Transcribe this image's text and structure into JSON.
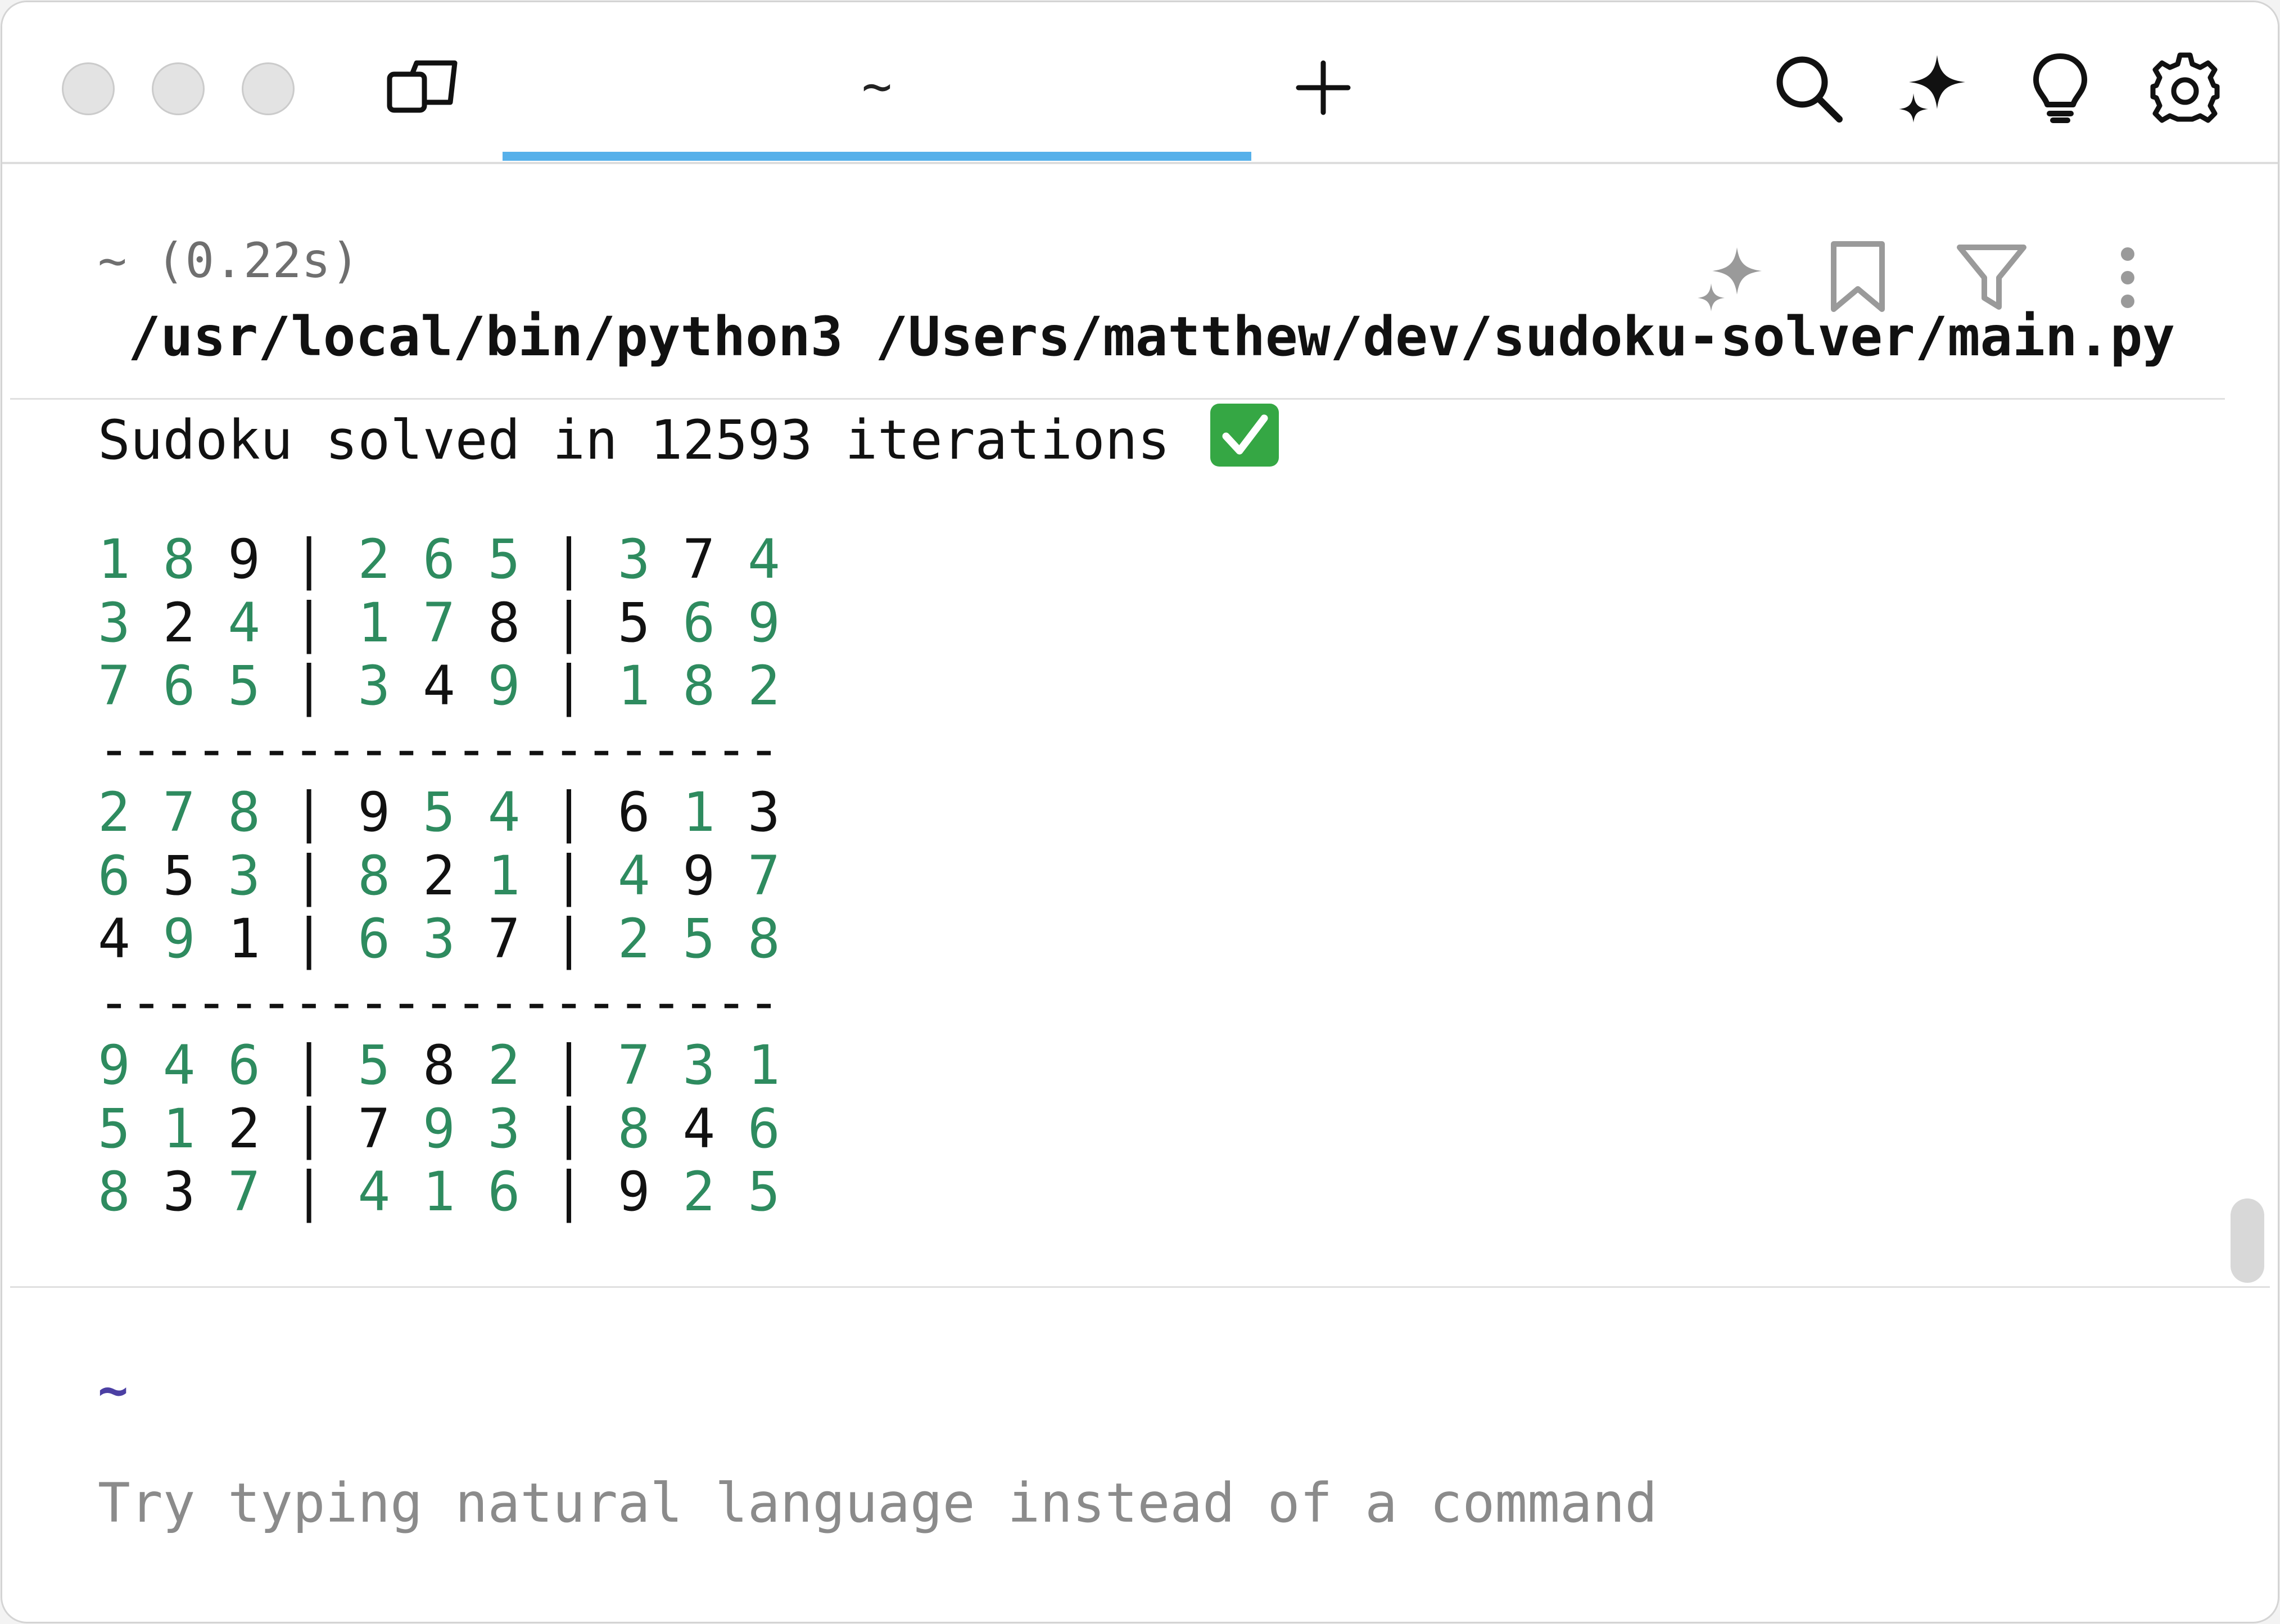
{
  "window": {
    "traffic_lights": [
      "close",
      "minimize",
      "zoom"
    ]
  },
  "tabs": [
    {
      "label": "~",
      "active": true
    }
  ],
  "toolbar": {
    "icons": [
      "search-icon",
      "ai-sparkle-icon",
      "lightbulb-icon",
      "gear-icon"
    ]
  },
  "block": {
    "meta": "~ (0.22s)",
    "command": "/usr/local/bin/python3 /Users/matthew/dev/sudoku-solver/main.py",
    "actions": [
      "ai-sparkle-icon",
      "bookmark-icon",
      "filter-icon",
      "more-vertical-icon"
    ],
    "output_text": "Sudoku solved in 12593 iterations",
    "output_icon": "check-mark-button-icon"
  },
  "grid": {
    "rows": [
      [
        "1",
        "8",
        "9",
        "2",
        "6",
        "5",
        "3",
        "7",
        "4"
      ],
      [
        "3",
        "2",
        "4",
        "1",
        "7",
        "8",
        "5",
        "6",
        "9"
      ],
      [
        "7",
        "6",
        "5",
        "3",
        "4",
        "9",
        "1",
        "8",
        "2"
      ],
      [
        "2",
        "7",
        "8",
        "9",
        "5",
        "4",
        "6",
        "1",
        "3"
      ],
      [
        "6",
        "5",
        "3",
        "8",
        "2",
        "1",
        "4",
        "9",
        "7"
      ],
      [
        "4",
        "9",
        "1",
        "6",
        "3",
        "7",
        "2",
        "5",
        "8"
      ],
      [
        "9",
        "4",
        "6",
        "5",
        "8",
        "2",
        "7",
        "3",
        "1"
      ],
      [
        "5",
        "1",
        "2",
        "7",
        "9",
        "3",
        "8",
        "4",
        "6"
      ],
      [
        "8",
        "3",
        "7",
        "4",
        "1",
        "6",
        "9",
        "2",
        "5"
      ]
    ],
    "given": [
      [
        0,
        0,
        1,
        0,
        0,
        0,
        0,
        1,
        0
      ],
      [
        0,
        1,
        0,
        0,
        0,
        1,
        1,
        0,
        0
      ],
      [
        0,
        0,
        0,
        0,
        1,
        0,
        0,
        0,
        0
      ],
      [
        0,
        0,
        0,
        1,
        0,
        0,
        1,
        0,
        1
      ],
      [
        0,
        1,
        0,
        0,
        1,
        0,
        0,
        1,
        0
      ],
      [
        1,
        0,
        1,
        0,
        0,
        1,
        0,
        0,
        0
      ],
      [
        0,
        0,
        0,
        0,
        1,
        0,
        0,
        0,
        0
      ],
      [
        0,
        0,
        1,
        1,
        0,
        0,
        0,
        1,
        0
      ],
      [
        0,
        1,
        0,
        0,
        0,
        0,
        1,
        0,
        0
      ]
    ],
    "separator": "---------------------",
    "colors": {
      "solved": "#2e8b5f",
      "given": "#111111"
    }
  },
  "prompt": {
    "directory": "~",
    "placeholder": "Try typing natural language instead of a command"
  },
  "colors": {
    "tab_accent": "#56b0ea",
    "prompt_dir": "#4b3fa3"
  }
}
